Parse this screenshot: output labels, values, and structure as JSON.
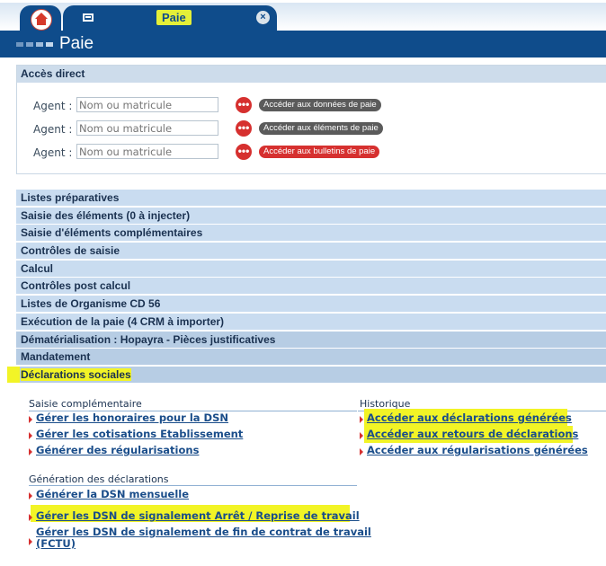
{
  "tabs": {
    "active_label": "Paie",
    "close_glyph": "×"
  },
  "header": {
    "title": "Paie"
  },
  "acces_direct": {
    "title": "Accès direct",
    "rows": [
      {
        "label": "Agent :",
        "placeholder": "Nom ou matricule",
        "button": "Accéder aux données de paie",
        "color": "#5b5b5b"
      },
      {
        "label": "Agent :",
        "placeholder": "Nom ou matricule",
        "button": "Accéder aux éléments de paie",
        "color": "#5b5b5b"
      },
      {
        "label": "Agent :",
        "placeholder": "Nom ou matricule",
        "button": "Accéder aux bulletins de paie",
        "color": "#d6302f"
      }
    ],
    "search_glyph": "•••"
  },
  "menu": [
    "Listes préparatives",
    "Saisie des éléments (0 à injecter)",
    "Saisie d'éléments complémentaires",
    "Contrôles de saisie",
    "Calcul",
    "Contrôles post calcul",
    "Listes de Organisme CD 56",
    "Exécution de la paie (4 CRM à importer)",
    "Dématérialisation : Hopayra - Pièces justificatives",
    "Mandatement",
    "Déclarations sociales"
  ],
  "panel": {
    "saisie": {
      "title": "Saisie complémentaire",
      "links": [
        "Gérer les honoraires pour la DSN",
        "Gérer les cotisations Etablissement",
        "Générer des régularisations"
      ]
    },
    "historique": {
      "title": "Historique",
      "links": [
        "Accéder aux déclarations générées",
        "Accéder aux retours de déclarations",
        "Accéder aux régularisations générées"
      ]
    },
    "generation": {
      "title": "Génération des déclarations",
      "links": [
        "Générer la DSN mensuelle",
        "Gérer les DSN de signalement Arrêt / Reprise de travail",
        "Gérer les DSN de signalement de fin de contrat de travail",
        "(FCTU)"
      ]
    }
  },
  "colors": {
    "brand": "#0f4c8b",
    "highlight": "#f2f426",
    "accent_red": "#d6302f"
  }
}
